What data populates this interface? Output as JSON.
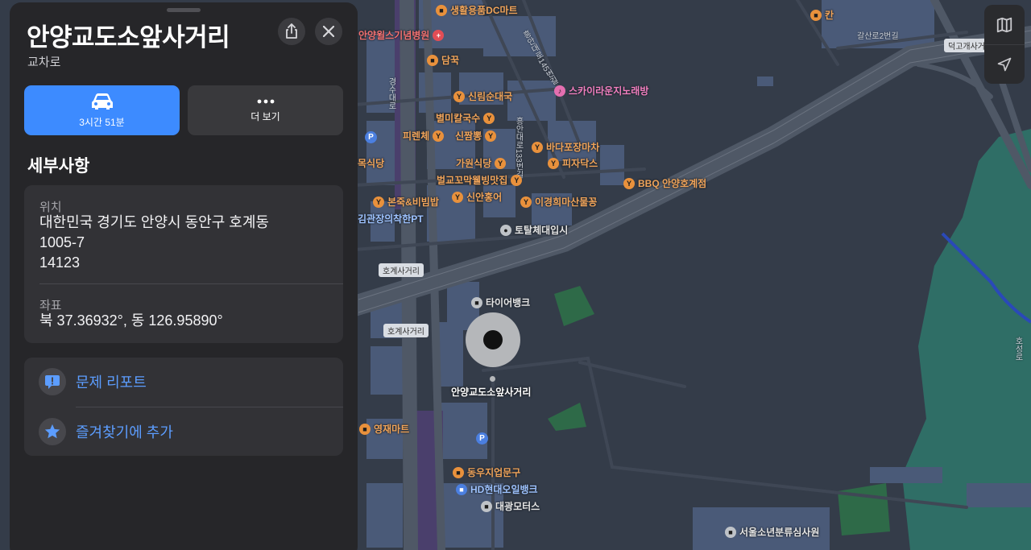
{
  "panel": {
    "title": "안양교도소앞사거리",
    "subtitle": "교차로",
    "share_icon": "share-icon",
    "close_icon": "close-icon",
    "actions": {
      "directions_label": "3시간 51분",
      "more_label": "더 보기"
    },
    "details_heading": "세부사항",
    "location_label": "위치",
    "address_line1": "대한민국 경기도 안양시 동안구 호계동",
    "address_line2": "1005-7",
    "postal_code": "14123",
    "coords_label": "좌표",
    "coords_value": "북 37.36932°, 동 126.95890°",
    "report_label": "문제 리포트",
    "favorite_label": "즐겨찾기에 추가"
  },
  "map": {
    "pin_label": "안양교도소앞사거리",
    "pois": [
      {
        "name": "생활용품DC마트",
        "style": "orange",
        "icon": "bag-icon"
      },
      {
        "name": "안양윌스기념병원",
        "style": "red",
        "icon": "hospital-icon"
      },
      {
        "name": "담꾹",
        "style": "orange",
        "icon": "cart-icon"
      },
      {
        "name": "신림순대국",
        "style": "orange",
        "icon": "fork-knife-icon"
      },
      {
        "name": "스카이라운지노래방",
        "style": "pink",
        "icon": "mic-icon"
      },
      {
        "name": "별미칼국수",
        "style": "orange",
        "icon": "fork-knife-icon"
      },
      {
        "name": "피렌체",
        "style": "orange",
        "icon": "fork-knife-icon"
      },
      {
        "name": "신짬뽕",
        "style": "orange",
        "icon": "fork-knife-icon"
      },
      {
        "name": "바다포장마차",
        "style": "orange",
        "icon": "cup-icon"
      },
      {
        "name": "가원식당",
        "style": "orange",
        "icon": "fork-knife-icon"
      },
      {
        "name": "피자닥스",
        "style": "orange",
        "icon": "fork-knife-icon"
      },
      {
        "name": "벌교꼬막웰빙맛집",
        "style": "orange",
        "icon": "fork-knife-icon"
      },
      {
        "name": "BBQ 안양호계점",
        "style": "orange",
        "icon": "fork-knife-icon"
      },
      {
        "name": "신안홍어",
        "style": "orange",
        "icon": "fork-knife-icon"
      },
      {
        "name": "본죽&비빔밥",
        "style": "orange",
        "icon": "fork-knife-icon"
      },
      {
        "name": "이경희마산물꽁",
        "style": "orange",
        "icon": "fork-knife-icon"
      },
      {
        "name": "김관장의착한PT",
        "style": "blue",
        "icon": "dumbbell-icon"
      },
      {
        "name": "토탈체대입시",
        "style": "gray",
        "icon": "school-icon"
      },
      {
        "name": "타이어뱅크",
        "style": "gray",
        "icon": "car-icon"
      },
      {
        "name": "영재마트",
        "style": "orange",
        "icon": "cart-icon"
      },
      {
        "name": "동우지업문구",
        "style": "orange",
        "icon": "bag-icon"
      },
      {
        "name": "HD현대오일뱅크",
        "style": "blue",
        "icon": "fuel-icon"
      },
      {
        "name": "대광모터스",
        "style": "gray",
        "icon": "car-icon"
      },
      {
        "name": "서울소년분류심사원",
        "style": "gray",
        "icon": "building-icon"
      },
      {
        "name": "칸",
        "style": "orange",
        "icon": "bag-icon"
      },
      {
        "name": "목식당",
        "style": "orange",
        "icon": "fork-knife-icon"
      }
    ],
    "roads": {
      "r1": "흥안대로145번길",
      "r2": "경수대로",
      "r3": "흥안대로133번길",
      "r4": "갈산로2번길",
      "r5": "덕고개사거",
      "r6": "호성로",
      "shield1": "호계사거리",
      "shield2": "호계사거리"
    },
    "controls": {
      "map_icon": "map-icon",
      "location_icon": "location-arrow-icon"
    }
  }
}
